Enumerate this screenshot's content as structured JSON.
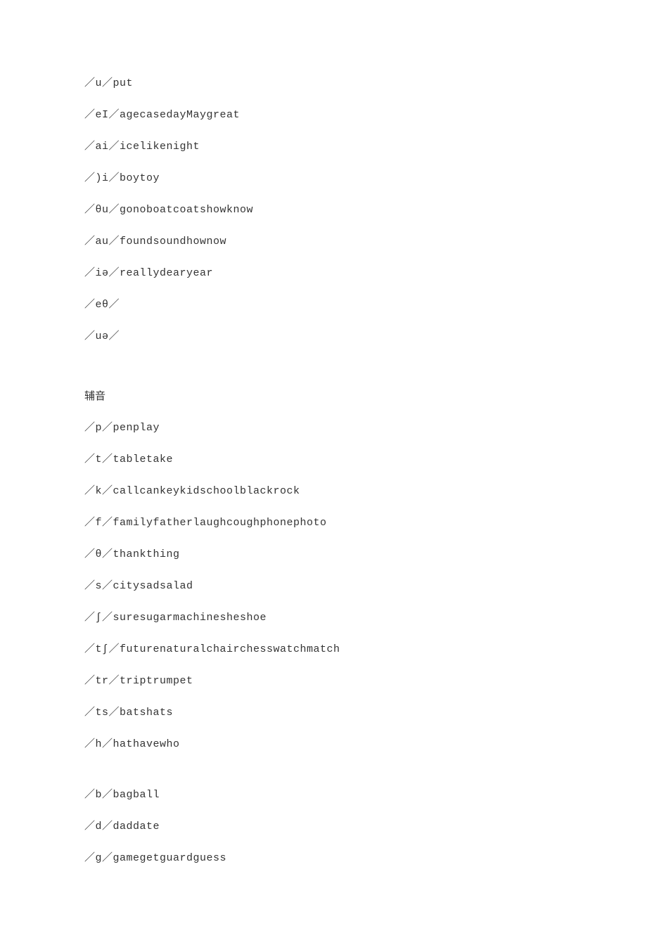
{
  "vowels": [
    "／u／put",
    "／eI／agecasedayMaygreat",
    "／ai／icelikenight",
    "／)i／boytoy",
    "／θu／gonoboatcoatshowknow",
    "／au／foundsoundhownow",
    "／iə／reallydearyear",
    "／eθ／",
    "／uə／"
  ],
  "consonants_heading": "辅音",
  "consonants_group1": [
    "／p／penplay",
    "／t／tabletake",
    "／k／callcankeykidschoolblackrock",
    "／f／familyfatherlaughcoughphonephoto",
    "／θ／thankthing",
    "／s／citysadsalad",
    "／∫／suresugarmachinesheshoe",
    "／t∫／futurenaturalchairchesswatchmatch",
    "／tr／triptrumpet",
    "／ts／batshats",
    "／h／hathavewho"
  ],
  "consonants_group2": [
    "／b／bagball",
    "／d／daddate",
    "／g／gamegetguardguess"
  ]
}
